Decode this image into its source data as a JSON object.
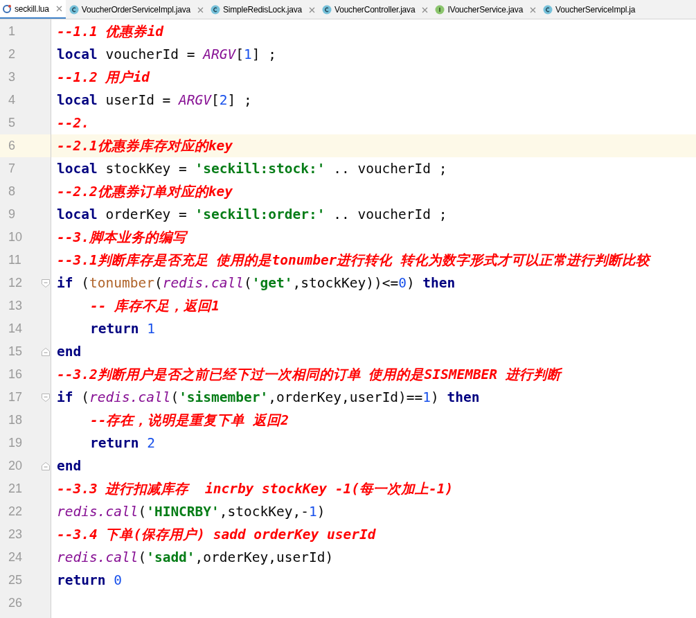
{
  "tabs": [
    {
      "label": "seckill.lua",
      "kind": "lua",
      "selected": true,
      "closable": true
    },
    {
      "label": "VoucherOrderServiceImpl.java",
      "kind": "class",
      "selected": false,
      "closable": true
    },
    {
      "label": "SimpleRedisLock.java",
      "kind": "class",
      "selected": false,
      "closable": true
    },
    {
      "label": "VoucherController.java",
      "kind": "class",
      "selected": false,
      "closable": true
    },
    {
      "label": "IVoucherService.java",
      "kind": "interface",
      "selected": false,
      "closable": true
    },
    {
      "label": "VoucherServiceImpl.ja",
      "kind": "class",
      "selected": false,
      "closable": false
    }
  ],
  "lines": [
    {
      "number": "1",
      "current": false,
      "segments": [
        {
          "kind": "comment",
          "text": "--1.1 优惠券id"
        }
      ]
    },
    {
      "number": "2",
      "current": false,
      "segments": [
        {
          "kind": "keyword",
          "text": "local"
        },
        {
          "kind": "plain",
          "text": " voucherId = "
        },
        {
          "kind": "global",
          "text": "ARGV"
        },
        {
          "kind": "plain",
          "text": "["
        },
        {
          "kind": "number",
          "text": "1"
        },
        {
          "kind": "plain",
          "text": "] ;"
        }
      ]
    },
    {
      "number": "3",
      "current": false,
      "segments": [
        {
          "kind": "comment",
          "text": "--1.2 用户id"
        }
      ]
    },
    {
      "number": "4",
      "current": false,
      "segments": [
        {
          "kind": "keyword",
          "text": "local"
        },
        {
          "kind": "plain",
          "text": " userId = "
        },
        {
          "kind": "global",
          "text": "ARGV"
        },
        {
          "kind": "plain",
          "text": "["
        },
        {
          "kind": "number",
          "text": "2"
        },
        {
          "kind": "plain",
          "text": "] ;"
        }
      ]
    },
    {
      "number": "5",
      "current": false,
      "segments": [
        {
          "kind": "comment",
          "text": "--2."
        }
      ]
    },
    {
      "number": "6",
      "current": true,
      "segments": [
        {
          "kind": "comment",
          "text": "--2.1优惠券库存对应的key"
        }
      ]
    },
    {
      "number": "7",
      "current": false,
      "segments": [
        {
          "kind": "keyword",
          "text": "local"
        },
        {
          "kind": "plain",
          "text": " stockKey = "
        },
        {
          "kind": "string",
          "text": "'seckill:stock:'"
        },
        {
          "kind": "plain",
          "text": " .. voucherId ;"
        }
      ]
    },
    {
      "number": "8",
      "current": false,
      "segments": [
        {
          "kind": "comment",
          "text": "--2.2优惠券订单对应的key"
        }
      ]
    },
    {
      "number": "9",
      "current": false,
      "segments": [
        {
          "kind": "keyword",
          "text": "local"
        },
        {
          "kind": "plain",
          "text": " orderKey = "
        },
        {
          "kind": "string",
          "text": "'seckill:order:'"
        },
        {
          "kind": "plain",
          "text": " .. voucherId ;"
        }
      ]
    },
    {
      "number": "10",
      "current": false,
      "segments": [
        {
          "kind": "comment",
          "text": "--3.脚本业务的编写"
        }
      ]
    },
    {
      "number": "11",
      "current": false,
      "segments": [
        {
          "kind": "comment",
          "text": "--3.1判断库存是否充足 使用的是tonumber进行转化 转化为数字形式才可以正常进行判断比较"
        }
      ]
    },
    {
      "number": "12",
      "current": false,
      "fold_start": true,
      "segments": [
        {
          "kind": "keyword",
          "text": "if"
        },
        {
          "kind": "plain",
          "text": " ("
        },
        {
          "kind": "function",
          "text": "tonumber"
        },
        {
          "kind": "plain",
          "text": "("
        },
        {
          "kind": "global",
          "text": "redis.call"
        },
        {
          "kind": "plain",
          "text": "("
        },
        {
          "kind": "string",
          "text": "'get'"
        },
        {
          "kind": "plain",
          "text": ",stockKey))<="
        },
        {
          "kind": "number",
          "text": "0"
        },
        {
          "kind": "plain",
          "text": ")"
        },
        {
          "kind": "keyword",
          "text": " then"
        }
      ]
    },
    {
      "number": "13",
      "current": false,
      "indented": true,
      "segments": [
        {
          "kind": "comment",
          "text": "-- 库存不足，返回1"
        }
      ]
    },
    {
      "number": "14",
      "current": false,
      "indented": true,
      "segments": [
        {
          "kind": "keyword",
          "text": "return"
        },
        {
          "kind": "number",
          "text": " 1"
        }
      ]
    },
    {
      "number": "15",
      "current": false,
      "fold_end": true,
      "segments": [
        {
          "kind": "keyword",
          "text": "end"
        }
      ]
    },
    {
      "number": "16",
      "current": false,
      "segments": [
        {
          "kind": "comment",
          "text": "--3.2判断用户是否之前已经下过一次相同的订单 使用的是SISMEMBER 进行判断"
        }
      ]
    },
    {
      "number": "17",
      "current": false,
      "fold_start": true,
      "segments": [
        {
          "kind": "keyword",
          "text": "if"
        },
        {
          "kind": "plain",
          "text": " ("
        },
        {
          "kind": "global",
          "text": "redis.call"
        },
        {
          "kind": "plain",
          "text": "("
        },
        {
          "kind": "string",
          "text": "'sismember'"
        },
        {
          "kind": "plain",
          "text": ",orderKey,userId)=="
        },
        {
          "kind": "number",
          "text": "1"
        },
        {
          "kind": "plain",
          "text": ")"
        },
        {
          "kind": "keyword",
          "text": " then"
        }
      ]
    },
    {
      "number": "18",
      "current": false,
      "indented": true,
      "segments": [
        {
          "kind": "comment",
          "text": "--存在，说明是重复下单 返回2"
        }
      ]
    },
    {
      "number": "19",
      "current": false,
      "indented": true,
      "segments": [
        {
          "kind": "keyword",
          "text": "return"
        },
        {
          "kind": "number",
          "text": " 2"
        }
      ]
    },
    {
      "number": "20",
      "current": false,
      "fold_end": true,
      "segments": [
        {
          "kind": "keyword",
          "text": "end"
        }
      ]
    },
    {
      "number": "21",
      "current": false,
      "segments": [
        {
          "kind": "comment",
          "text": "--3.3 进行扣减库存  incrby stockKey -1(每一次加上-1)"
        }
      ]
    },
    {
      "number": "22",
      "current": false,
      "segments": [
        {
          "kind": "global",
          "text": "redis.call"
        },
        {
          "kind": "plain",
          "text": "("
        },
        {
          "kind": "string",
          "text": "'HINCRBY'"
        },
        {
          "kind": "plain",
          "text": ",stockKey,-"
        },
        {
          "kind": "number",
          "text": "1"
        },
        {
          "kind": "plain",
          "text": ")"
        }
      ]
    },
    {
      "number": "23",
      "current": false,
      "segments": [
        {
          "kind": "comment",
          "text": "--3.4 下单(保存用户) sadd orderKey userId"
        }
      ]
    },
    {
      "number": "24",
      "current": false,
      "segments": [
        {
          "kind": "global",
          "text": "redis.call"
        },
        {
          "kind": "plain",
          "text": "("
        },
        {
          "kind": "string",
          "text": "'sadd'"
        },
        {
          "kind": "plain",
          "text": ",orderKey,userId)"
        }
      ]
    },
    {
      "number": "25",
      "current": false,
      "segments": [
        {
          "kind": "keyword",
          "text": "return"
        },
        {
          "kind": "number",
          "text": " 0"
        }
      ]
    },
    {
      "number": "26",
      "current": false
    }
  ]
}
